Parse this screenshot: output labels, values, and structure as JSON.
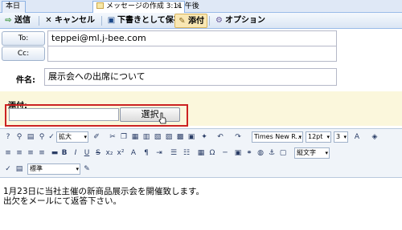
{
  "tabs": [
    {
      "label": "本日"
    },
    {
      "label": "メッセージの作成 3:11 午後",
      "close": "×"
    }
  ],
  "toolbar": {
    "send": "送信",
    "cancel": "キャンセル",
    "save_draft": "下書きとして保存",
    "attach": "添付",
    "options": "オプション"
  },
  "to": {
    "button": "To:",
    "value": "teppei@ml.j-bee.com"
  },
  "cc": {
    "button": "Cc:",
    "value": ""
  },
  "subject": {
    "label": "件名:",
    "value": "展示会への出席について"
  },
  "attachment": {
    "label": "添付:",
    "select_button": "選択"
  },
  "editor": {
    "zoom": "拡大",
    "font_family": "Times New R...",
    "font_size": "12pt",
    "size_num": "3",
    "text_direction": "縦文字",
    "style": "標準"
  },
  "body": {
    "lines": [
      "1月23日に当社主催の新商品展示会を開催致します。",
      "出欠をメールにて返答下さい。"
    ]
  }
}
